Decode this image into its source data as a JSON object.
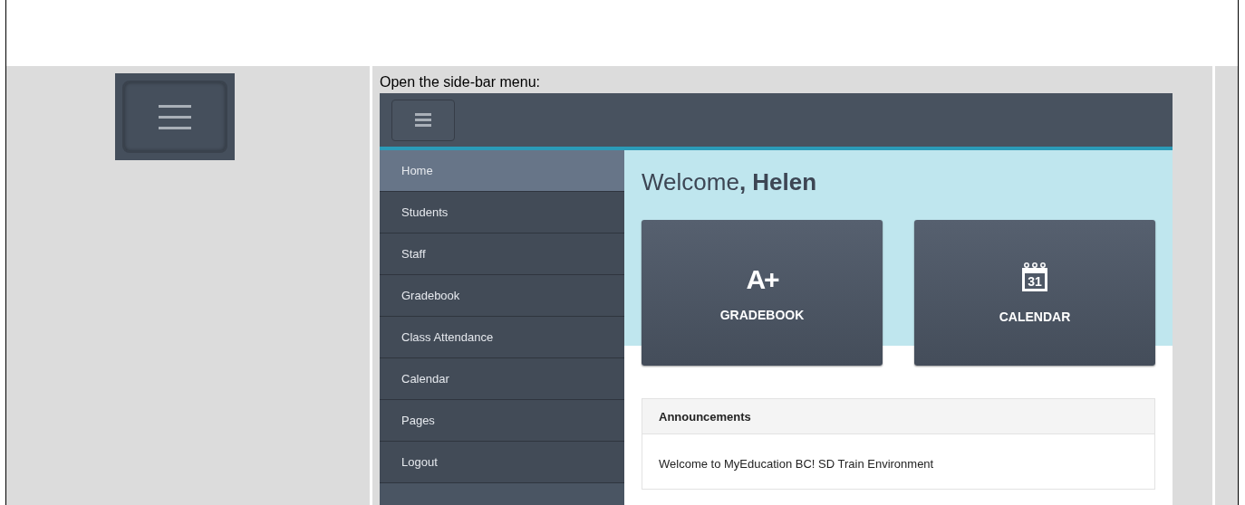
{
  "instruction": {
    "text": "Open the side-bar menu:"
  },
  "screenshot": {
    "nav_items": [
      {
        "label": "Home",
        "selected": true
      },
      {
        "label": "Students",
        "selected": false
      },
      {
        "label": "Staff",
        "selected": false
      },
      {
        "label": "Gradebook",
        "selected": false
      },
      {
        "label": "Class Attendance",
        "selected": false
      },
      {
        "label": "Calendar",
        "selected": false
      },
      {
        "label": "Pages",
        "selected": false
      },
      {
        "label": "Logout",
        "selected": false
      }
    ],
    "welcome": "Welcome**, Helen**",
    "tiles": [
      {
        "kind": "grade",
        "glyph": "A+",
        "label": "GRADEBOOK"
      },
      {
        "kind": "calendar",
        "glyph": "31",
        "label": "CALENDAR"
      }
    ],
    "announcements": {
      "title": "Announcements",
      "items": [
        "Welcome to MyEducation BC! SD Train Environment"
      ]
    }
  }
}
